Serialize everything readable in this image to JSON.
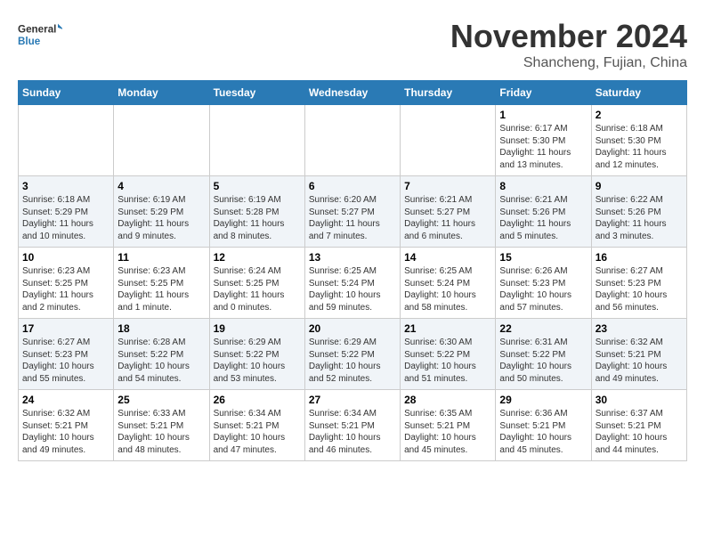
{
  "header": {
    "logo_general": "General",
    "logo_blue": "Blue",
    "month_title": "November 2024",
    "location": "Shancheng, Fujian, China"
  },
  "days_of_week": [
    "Sunday",
    "Monday",
    "Tuesday",
    "Wednesday",
    "Thursday",
    "Friday",
    "Saturday"
  ],
  "weeks": [
    [
      {
        "day": "",
        "info": ""
      },
      {
        "day": "",
        "info": ""
      },
      {
        "day": "",
        "info": ""
      },
      {
        "day": "",
        "info": ""
      },
      {
        "day": "",
        "info": ""
      },
      {
        "day": "1",
        "info": "Sunrise: 6:17 AM\nSunset: 5:30 PM\nDaylight: 11 hours and 13 minutes."
      },
      {
        "day": "2",
        "info": "Sunrise: 6:18 AM\nSunset: 5:30 PM\nDaylight: 11 hours and 12 minutes."
      }
    ],
    [
      {
        "day": "3",
        "info": "Sunrise: 6:18 AM\nSunset: 5:29 PM\nDaylight: 11 hours and 10 minutes."
      },
      {
        "day": "4",
        "info": "Sunrise: 6:19 AM\nSunset: 5:29 PM\nDaylight: 11 hours and 9 minutes."
      },
      {
        "day": "5",
        "info": "Sunrise: 6:19 AM\nSunset: 5:28 PM\nDaylight: 11 hours and 8 minutes."
      },
      {
        "day": "6",
        "info": "Sunrise: 6:20 AM\nSunset: 5:27 PM\nDaylight: 11 hours and 7 minutes."
      },
      {
        "day": "7",
        "info": "Sunrise: 6:21 AM\nSunset: 5:27 PM\nDaylight: 11 hours and 6 minutes."
      },
      {
        "day": "8",
        "info": "Sunrise: 6:21 AM\nSunset: 5:26 PM\nDaylight: 11 hours and 5 minutes."
      },
      {
        "day": "9",
        "info": "Sunrise: 6:22 AM\nSunset: 5:26 PM\nDaylight: 11 hours and 3 minutes."
      }
    ],
    [
      {
        "day": "10",
        "info": "Sunrise: 6:23 AM\nSunset: 5:25 PM\nDaylight: 11 hours and 2 minutes."
      },
      {
        "day": "11",
        "info": "Sunrise: 6:23 AM\nSunset: 5:25 PM\nDaylight: 11 hours and 1 minute."
      },
      {
        "day": "12",
        "info": "Sunrise: 6:24 AM\nSunset: 5:25 PM\nDaylight: 11 hours and 0 minutes."
      },
      {
        "day": "13",
        "info": "Sunrise: 6:25 AM\nSunset: 5:24 PM\nDaylight: 10 hours and 59 minutes."
      },
      {
        "day": "14",
        "info": "Sunrise: 6:25 AM\nSunset: 5:24 PM\nDaylight: 10 hours and 58 minutes."
      },
      {
        "day": "15",
        "info": "Sunrise: 6:26 AM\nSunset: 5:23 PM\nDaylight: 10 hours and 57 minutes."
      },
      {
        "day": "16",
        "info": "Sunrise: 6:27 AM\nSunset: 5:23 PM\nDaylight: 10 hours and 56 minutes."
      }
    ],
    [
      {
        "day": "17",
        "info": "Sunrise: 6:27 AM\nSunset: 5:23 PM\nDaylight: 10 hours and 55 minutes."
      },
      {
        "day": "18",
        "info": "Sunrise: 6:28 AM\nSunset: 5:22 PM\nDaylight: 10 hours and 54 minutes."
      },
      {
        "day": "19",
        "info": "Sunrise: 6:29 AM\nSunset: 5:22 PM\nDaylight: 10 hours and 53 minutes."
      },
      {
        "day": "20",
        "info": "Sunrise: 6:29 AM\nSunset: 5:22 PM\nDaylight: 10 hours and 52 minutes."
      },
      {
        "day": "21",
        "info": "Sunrise: 6:30 AM\nSunset: 5:22 PM\nDaylight: 10 hours and 51 minutes."
      },
      {
        "day": "22",
        "info": "Sunrise: 6:31 AM\nSunset: 5:22 PM\nDaylight: 10 hours and 50 minutes."
      },
      {
        "day": "23",
        "info": "Sunrise: 6:32 AM\nSunset: 5:21 PM\nDaylight: 10 hours and 49 minutes."
      }
    ],
    [
      {
        "day": "24",
        "info": "Sunrise: 6:32 AM\nSunset: 5:21 PM\nDaylight: 10 hours and 49 minutes."
      },
      {
        "day": "25",
        "info": "Sunrise: 6:33 AM\nSunset: 5:21 PM\nDaylight: 10 hours and 48 minutes."
      },
      {
        "day": "26",
        "info": "Sunrise: 6:34 AM\nSunset: 5:21 PM\nDaylight: 10 hours and 47 minutes."
      },
      {
        "day": "27",
        "info": "Sunrise: 6:34 AM\nSunset: 5:21 PM\nDaylight: 10 hours and 46 minutes."
      },
      {
        "day": "28",
        "info": "Sunrise: 6:35 AM\nSunset: 5:21 PM\nDaylight: 10 hours and 45 minutes."
      },
      {
        "day": "29",
        "info": "Sunrise: 6:36 AM\nSunset: 5:21 PM\nDaylight: 10 hours and 45 minutes."
      },
      {
        "day": "30",
        "info": "Sunrise: 6:37 AM\nSunset: 5:21 PM\nDaylight: 10 hours and 44 minutes."
      }
    ]
  ]
}
